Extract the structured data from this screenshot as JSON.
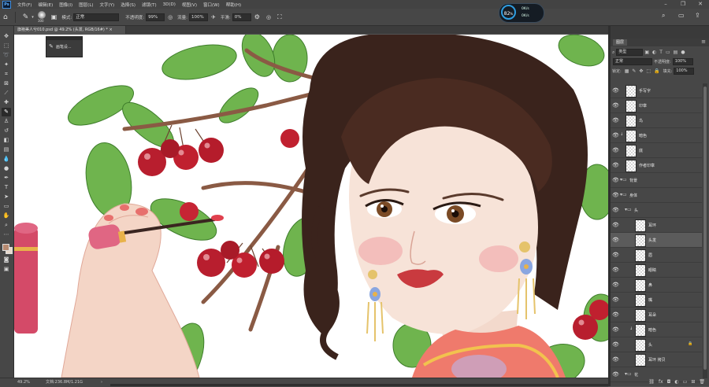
{
  "menubar": {
    "logo": "Ps",
    "items": [
      "文件(F)",
      "编辑(E)",
      "图像(I)",
      "图层(L)",
      "文字(Y)",
      "选择(S)",
      "滤镜(T)",
      "3D(D)",
      "视图(V)",
      "窗口(W)",
      "帮助(H)"
    ],
    "win_min": "–",
    "win_max": "❐",
    "win_close": "✕"
  },
  "options": {
    "brush_size": "300",
    "mode_label": "模式:",
    "mode_value": "正常",
    "opacity_label": "不透明度:",
    "opacity_value": "99%",
    "flow_label": "流量:",
    "flow_value": "100%",
    "smooth_label": "平滑:",
    "smooth_value": "0%"
  },
  "speedometer": {
    "value": "82",
    "unit": "%",
    "up": "0K/s",
    "down": "0K/s"
  },
  "document": {
    "tab_title": "旗袍美人兮010.psd @ 49.2% (头发, RGB/16#) *",
    "close": "×"
  },
  "tools": [
    "move-tool",
    "marquee-tool",
    "lasso-tool",
    "magic-wand-tool",
    "crop-tool",
    "frame-tool",
    "eyedropper-tool",
    "healing-tool",
    "brush-tool",
    "stamp-tool",
    "history-brush-tool",
    "eraser-tool",
    "gradient-tool",
    "blur-tool",
    "dodge-tool",
    "pen-tool",
    "type-tool",
    "path-select-tool",
    "shape-tool",
    "hand-tool",
    "zoom-tool",
    "more-tools",
    "color-swatches",
    "quick-mask",
    "screen-mode"
  ],
  "float_panel": {
    "label": "画笔设..."
  },
  "status": {
    "zoom": "49.2%",
    "doc": "文档:236.8M/1.21G",
    "arrow": "›"
  },
  "layers_panel": {
    "tab": "图层",
    "kind_label": "类型",
    "blend_mode": "正常",
    "opacity_label": "不透明度:",
    "opacity_value": "100%",
    "lock_label": "锁定:",
    "fill_label": "填充:",
    "fill_value": "100%",
    "layers": [
      {
        "name": "手写字",
        "type": "layer",
        "selected": false,
        "clip": false,
        "lock": false,
        "indent": 0
      },
      {
        "name": "印章",
        "type": "layer",
        "selected": false,
        "clip": false,
        "lock": false,
        "indent": 0
      },
      {
        "name": "鸟",
        "type": "layer",
        "selected": false,
        "clip": false,
        "lock": false,
        "indent": 0
      },
      {
        "name": "暗色",
        "type": "layer",
        "selected": false,
        "clip": true,
        "lock": false,
        "indent": 0
      },
      {
        "name": "底",
        "type": "layer",
        "selected": false,
        "clip": false,
        "lock": false,
        "indent": 0
      },
      {
        "name": "作者印章",
        "type": "layer",
        "selected": false,
        "clip": false,
        "lock": false,
        "indent": 0
      },
      {
        "name": "背景",
        "type": "group",
        "selected": false,
        "clip": false,
        "lock": false,
        "indent": 0
      },
      {
        "name": "身体",
        "type": "group",
        "selected": false,
        "clip": false,
        "lock": false,
        "indent": 0
      },
      {
        "name": "头",
        "type": "group",
        "selected": false,
        "clip": false,
        "lock": false,
        "indent": 1
      },
      {
        "name": "耳环",
        "type": "layer",
        "selected": false,
        "clip": false,
        "lock": false,
        "indent": 2
      },
      {
        "name": "头发",
        "type": "layer",
        "selected": true,
        "clip": false,
        "lock": false,
        "indent": 2
      },
      {
        "name": "眉",
        "type": "layer",
        "selected": false,
        "clip": false,
        "lock": false,
        "indent": 2
      },
      {
        "name": "眼睛",
        "type": "layer",
        "selected": false,
        "clip": false,
        "lock": false,
        "indent": 2
      },
      {
        "name": "鼻",
        "type": "layer",
        "selected": false,
        "clip": false,
        "lock": false,
        "indent": 2
      },
      {
        "name": "嘴",
        "type": "layer",
        "selected": false,
        "clip": false,
        "lock": false,
        "indent": 2
      },
      {
        "name": "耳朵",
        "type": "layer",
        "selected": false,
        "clip": false,
        "lock": false,
        "indent": 2
      },
      {
        "name": "暗色",
        "type": "layer",
        "selected": false,
        "clip": true,
        "lock": false,
        "indent": 2
      },
      {
        "name": "头",
        "type": "layer",
        "selected": false,
        "clip": false,
        "lock": true,
        "indent": 2
      },
      {
        "name": "耳环 拷贝",
        "type": "layer",
        "selected": false,
        "clip": false,
        "lock": false,
        "indent": 2
      },
      {
        "name": "花",
        "type": "group",
        "selected": false,
        "clip": false,
        "lock": false,
        "indent": 1
      }
    ]
  },
  "colors": {
    "foreground": "#b78a70",
    "background": "#e8d9cc",
    "selected_layer": "#5b5b5b"
  }
}
